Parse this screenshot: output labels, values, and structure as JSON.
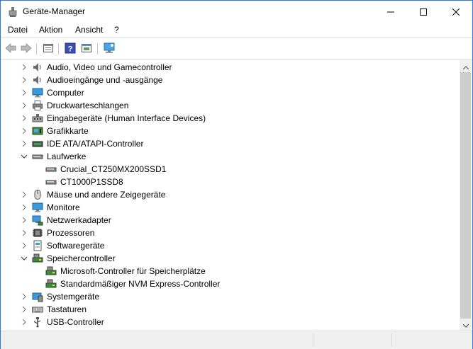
{
  "window": {
    "title": "Geräte-Manager"
  },
  "menu": {
    "items": [
      "Datei",
      "Aktion",
      "Ansicht",
      "?"
    ]
  },
  "tree": {
    "items": [
      {
        "label": "Audio, Video und Gamecontroller",
        "icon": "speaker-icon",
        "expanded": false,
        "level": 0
      },
      {
        "label": "Audioeingänge und -ausgänge",
        "icon": "speaker-icon",
        "expanded": false,
        "level": 0
      },
      {
        "label": "Computer",
        "icon": "monitor-icon",
        "expanded": false,
        "level": 0
      },
      {
        "label": "Druckwarteschlangen",
        "icon": "printer-icon",
        "expanded": false,
        "level": 0
      },
      {
        "label": "Eingabegeräte (Human Interface Devices)",
        "icon": "hid-icon",
        "expanded": false,
        "level": 0
      },
      {
        "label": "Grafikkarte",
        "icon": "display-adapter-icon",
        "expanded": false,
        "level": 0
      },
      {
        "label": "IDE ATA/ATAPI-Controller",
        "icon": "ide-controller-icon",
        "expanded": false,
        "level": 0
      },
      {
        "label": "Laufwerke",
        "icon": "disk-drive-icon",
        "expanded": true,
        "level": 0
      },
      {
        "label": "Crucial_CT250MX200SSD1",
        "icon": "disk-drive-icon",
        "expanded": null,
        "level": 1
      },
      {
        "label": "CT1000P1SSD8",
        "icon": "disk-drive-icon",
        "expanded": null,
        "level": 1
      },
      {
        "label": "Mäuse und andere Zeigegeräte",
        "icon": "mouse-icon",
        "expanded": false,
        "level": 0
      },
      {
        "label": "Monitore",
        "icon": "monitor-icon",
        "expanded": false,
        "level": 0
      },
      {
        "label": "Netzwerkadapter",
        "icon": "network-adapter-icon",
        "expanded": false,
        "level": 0
      },
      {
        "label": "Prozessoren",
        "icon": "processor-icon",
        "expanded": false,
        "level": 0
      },
      {
        "label": "Softwaregeräte",
        "icon": "software-device-icon",
        "expanded": false,
        "level": 0
      },
      {
        "label": "Speichercontroller",
        "icon": "storage-controller-icon",
        "expanded": true,
        "level": 0
      },
      {
        "label": "Microsoft-Controller für Speicherplätze",
        "icon": "storage-controller-icon",
        "expanded": null,
        "level": 1
      },
      {
        "label": "Standardmäßiger NVM Express-Controller",
        "icon": "storage-controller-icon",
        "expanded": null,
        "level": 1
      },
      {
        "label": "Systemgeräte",
        "icon": "system-device-icon",
        "expanded": false,
        "level": 0
      },
      {
        "label": "Tastaturen",
        "icon": "keyboard-icon",
        "expanded": false,
        "level": 0
      },
      {
        "label": "USB-Controller",
        "icon": "usb-icon",
        "expanded": false,
        "level": 0
      }
    ]
  },
  "colors": {
    "accent": "#2b7bd6",
    "scroll_thumb": "#cdcdcd",
    "toolbar_border": "#dcdcdc"
  }
}
